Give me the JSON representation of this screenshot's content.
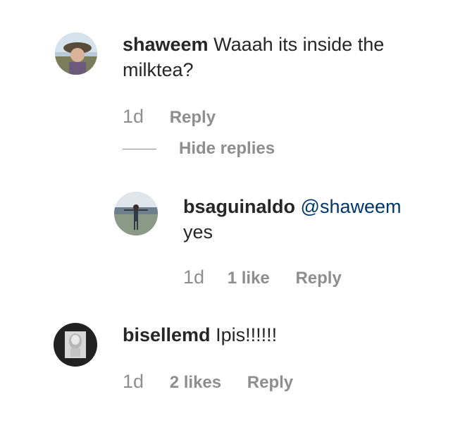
{
  "comments": [
    {
      "username": "shaweem",
      "text": "Waaah its inside the",
      "text_line2": "milktea?",
      "time": "1d",
      "reply_label": "Reply",
      "avatar_icon": "user-photo-avatar"
    }
  ],
  "hide_replies_label": "Hide replies",
  "reply": {
    "username": "bsaguinaldo",
    "mention": "@shaweem",
    "text": "yes",
    "time": "1d",
    "likes_label": "1 like",
    "reply_label": "Reply",
    "avatar_icon": "user-photo-avatar"
  },
  "comment2": {
    "username": "bisellemd",
    "text": "Ipis!!!!!!",
    "time": "1d",
    "likes_label": "2 likes",
    "reply_label": "Reply",
    "avatar_icon": "user-photo-avatar"
  },
  "colors": {
    "username": "#262626",
    "meta": "#8e8e8e",
    "mention": "#00376b"
  }
}
